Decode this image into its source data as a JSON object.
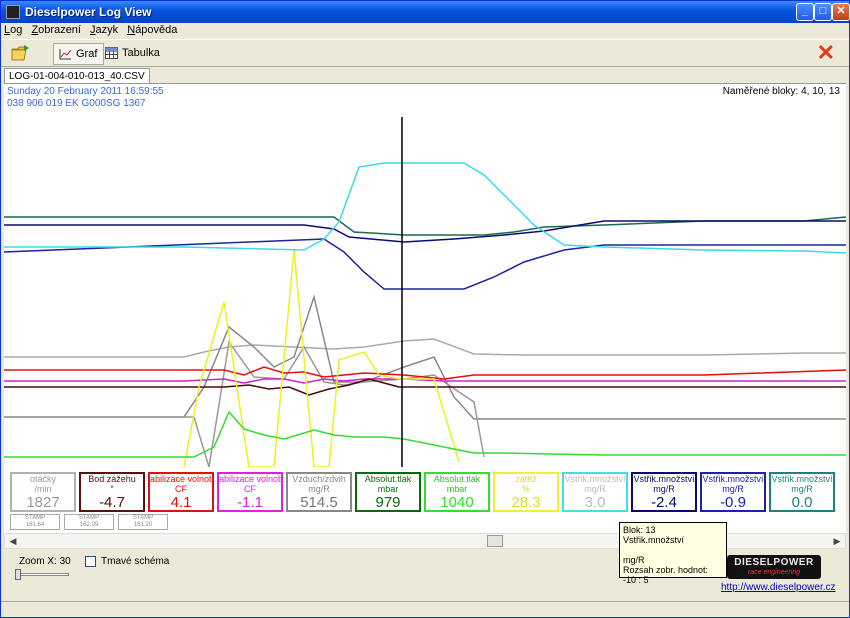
{
  "window": {
    "title": "Dieselpower Log View"
  },
  "menu": [
    "Log",
    "Zobrazení",
    "Jazyk",
    "Nápověda"
  ],
  "toolbar": {
    "graf_label": "Graf",
    "tabulka_label": "Tabulka"
  },
  "file_tab": "LOG-01-004-010-013_40.CSV",
  "info": {
    "date": "Sunday 20 February 2011 16:59:55",
    "ecu": "038 906 019 EK  G000SG  1367",
    "blocks": "Naměřené bloky: 4, 10, 13"
  },
  "channels": [
    {
      "name": "otáčky",
      "unit": "/min",
      "value": "1827",
      "color": "#b0b0b0",
      "value_color": "#999999"
    },
    {
      "name": "Bod zážehu",
      "unit": "°",
      "value": "-4.7",
      "color": "#5a1010",
      "value_color": "#5a1010"
    },
    {
      "name": "abilizace volnoběh",
      "unit": "CF",
      "value": "4.1",
      "color": "#e01010",
      "value_color": "#e01010"
    },
    {
      "name": "abilizace volnoběh",
      "unit": "CF",
      "value": "-1.1",
      "color": "#e020e0",
      "value_color": "#e020e0"
    },
    {
      "name": "Vzduch/zdvih",
      "unit": "mg/R",
      "value": "514.5",
      "color": "#888888",
      "value_color": "#777777"
    },
    {
      "name": "Absolut.tlak",
      "unit": "mbar",
      "value": "979",
      "color": "#0a6a0a",
      "value_color": "#0a6a0a"
    },
    {
      "name": "Absolut.tlak",
      "unit": "mbar",
      "value": "1040",
      "color": "#30dd30",
      "value_color": "#30dd30"
    },
    {
      "name": "zátěž",
      "unit": "%",
      "value": "28.3",
      "color": "#f0f030",
      "value_color": "#e0e020"
    },
    {
      "name": "Vstřik.množství",
      "unit": "mg/R",
      "value": "3.0",
      "color": "#40e0e0",
      "value_color": "#bbbbbb"
    },
    {
      "name": "Vstřik.množství",
      "unit": "mg/R",
      "value": "-2.4",
      "color": "#0a0a6a",
      "value_color": "#0a0a6a"
    },
    {
      "name": "Vstřik.množství",
      "unit": "mg/R",
      "value": "-0.9",
      "color": "#2020b0",
      "value_color": "#2020b0"
    },
    {
      "name": "Vstřik.množství",
      "unit": "mg/R",
      "value": "0.0",
      "color": "#208080",
      "value_color": "#208080"
    }
  ],
  "stamps": [
    {
      "label": "STAMP",
      "value": "161.64"
    },
    {
      "label": "STAMP",
      "value": "162.09"
    },
    {
      "label": "STAMP",
      "value": "161.20"
    }
  ],
  "tooltip": {
    "block": "Blok: 13",
    "name": "Vstřik.množství",
    "unit": "mg/R",
    "range": "Rozsah zobr. hodnot: -10 : 5"
  },
  "zoom_label": "Zoom X: 30",
  "dark_scheme_label": "Tmavé schéma",
  "logo": {
    "line1": "DIESELPOWER",
    "line2": "race engineering"
  },
  "website": "http://www.dieselpower.cz"
}
